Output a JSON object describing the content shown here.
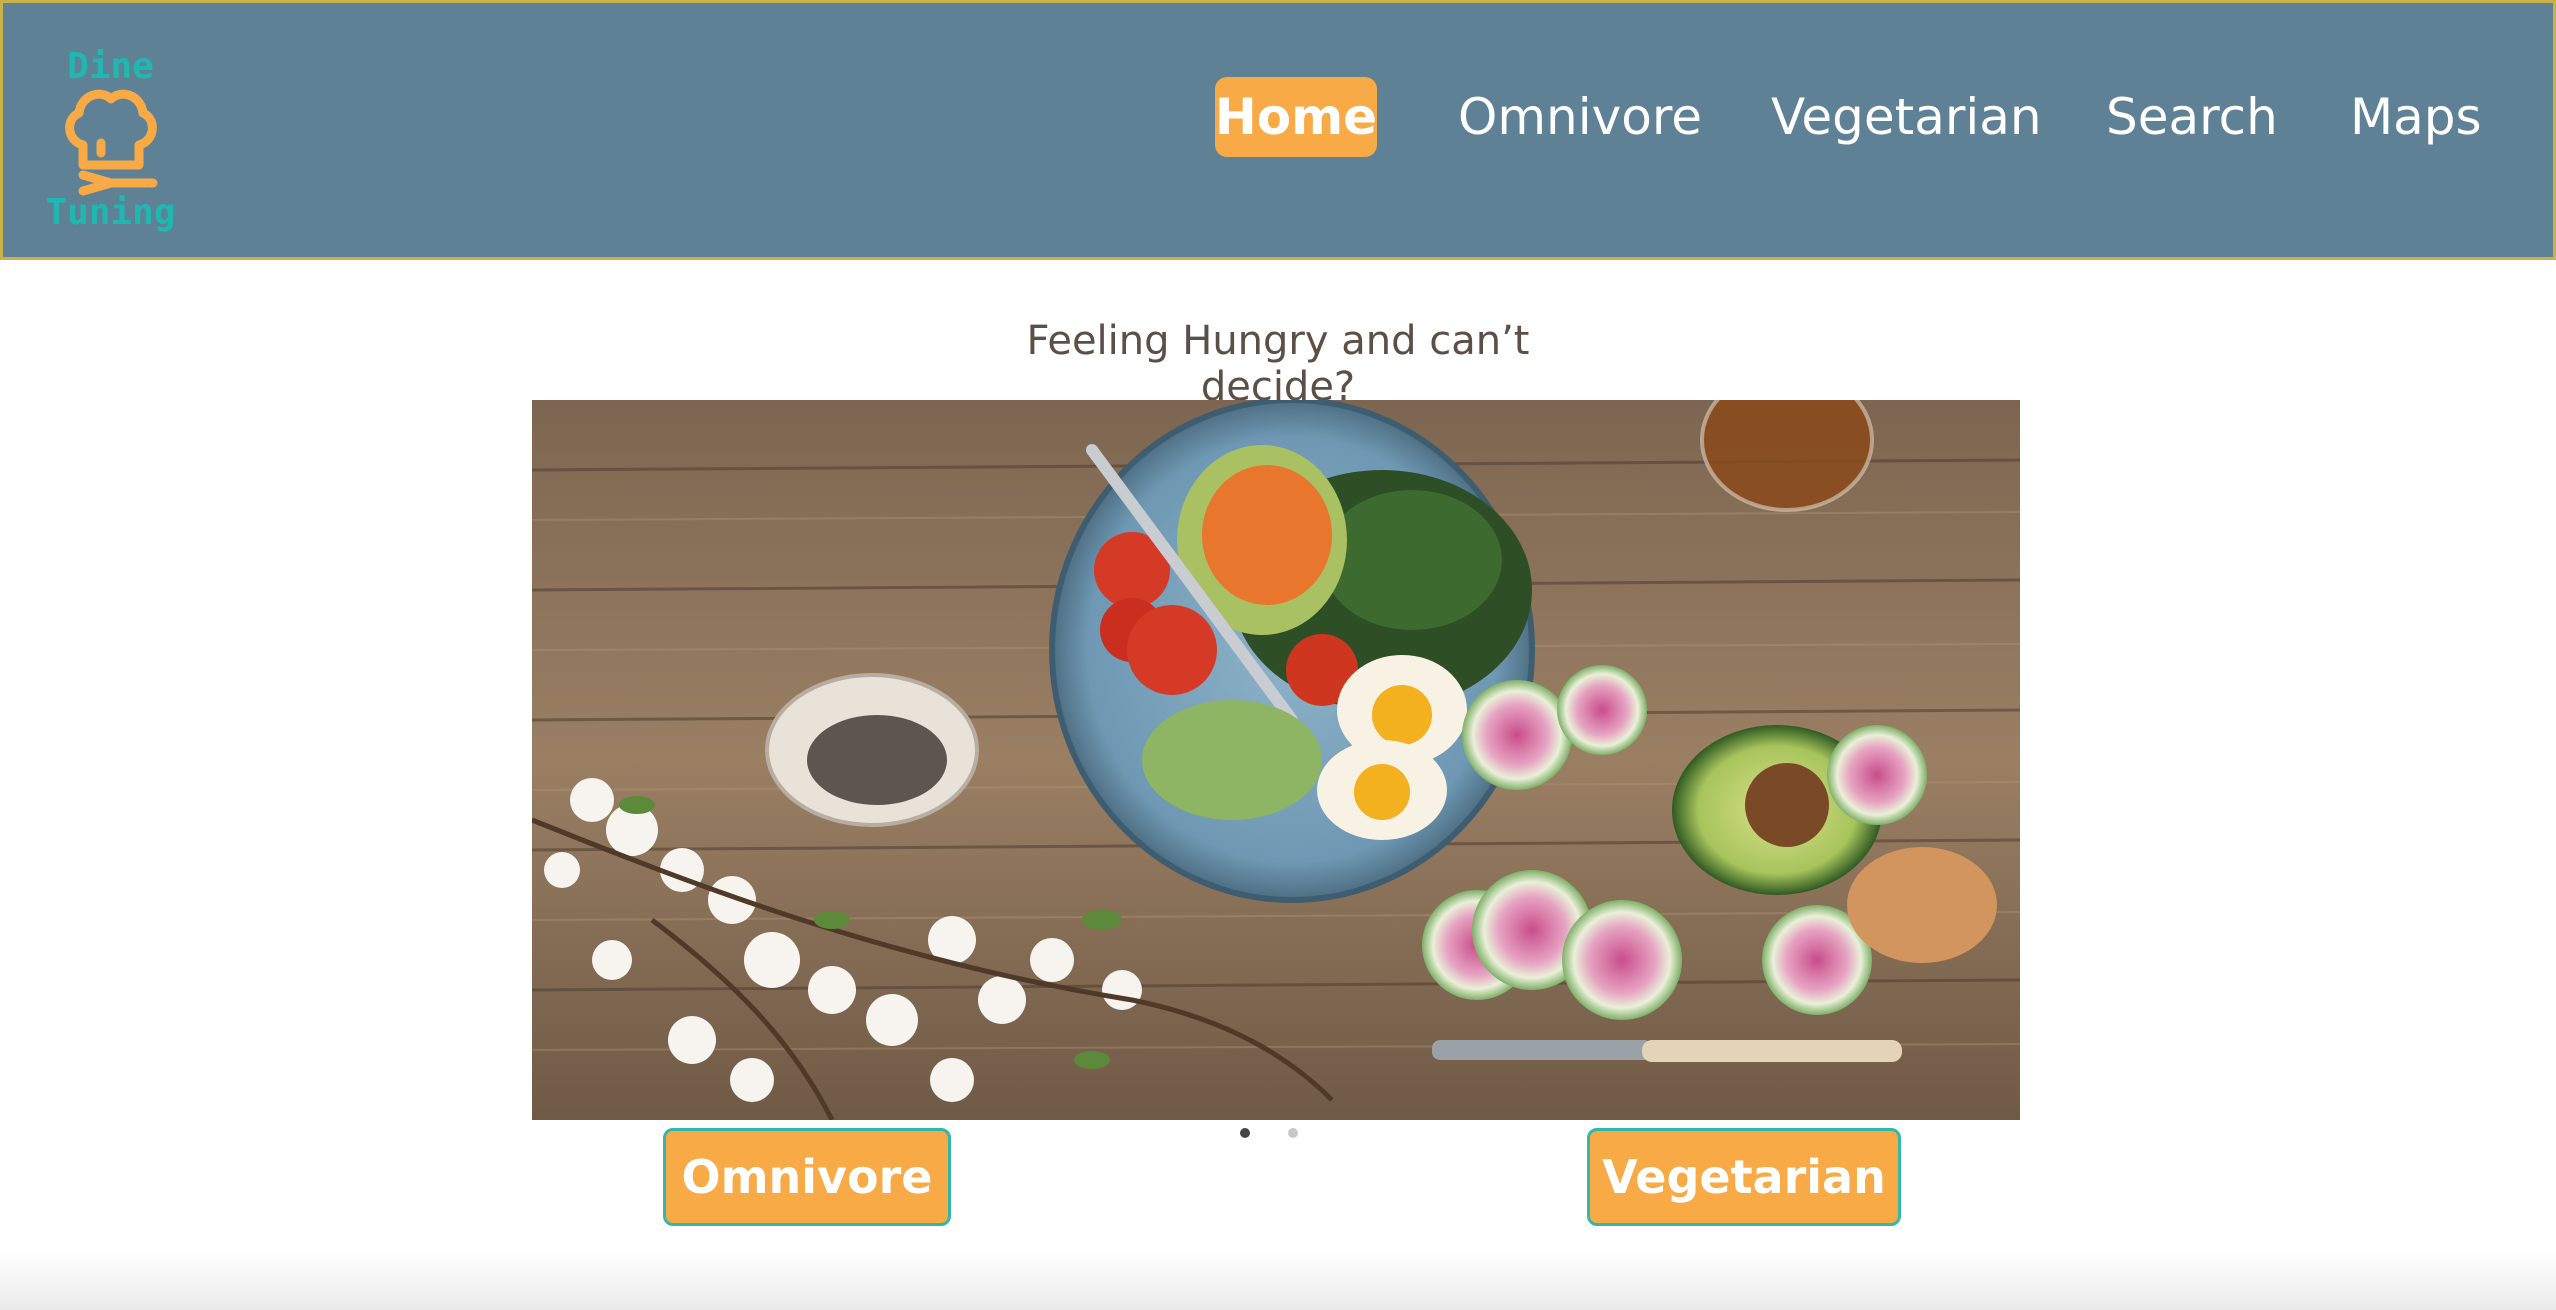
{
  "brand": {
    "logo_top": "Dine",
    "logo_bottom": "Tuning",
    "logo_text_color": "#1fb8b0",
    "logo_icon_color": "#f7aa45",
    "icon": "chef-hat-fork-icon"
  },
  "nav": {
    "items": [
      {
        "label": "Home",
        "active": true
      },
      {
        "label": "Omnivore",
        "active": false
      },
      {
        "label": "Vegetarian",
        "active": false
      },
      {
        "label": "Search",
        "active": false
      },
      {
        "label": "Maps",
        "active": false
      }
    ]
  },
  "main": {
    "tagline": "Feeling Hungry and can’t decide?",
    "carousel": {
      "slide_count": 2,
      "active_index": 0
    },
    "buttons": {
      "omnivore": "Omnivore",
      "vegetarian": "Vegetarian"
    }
  },
  "colors": {
    "header_bg": "#5f8195",
    "header_border": "#c9b24a",
    "accent": "#f7aa45",
    "button_border": "#33b8a8",
    "tagline": "#5b4f46"
  }
}
